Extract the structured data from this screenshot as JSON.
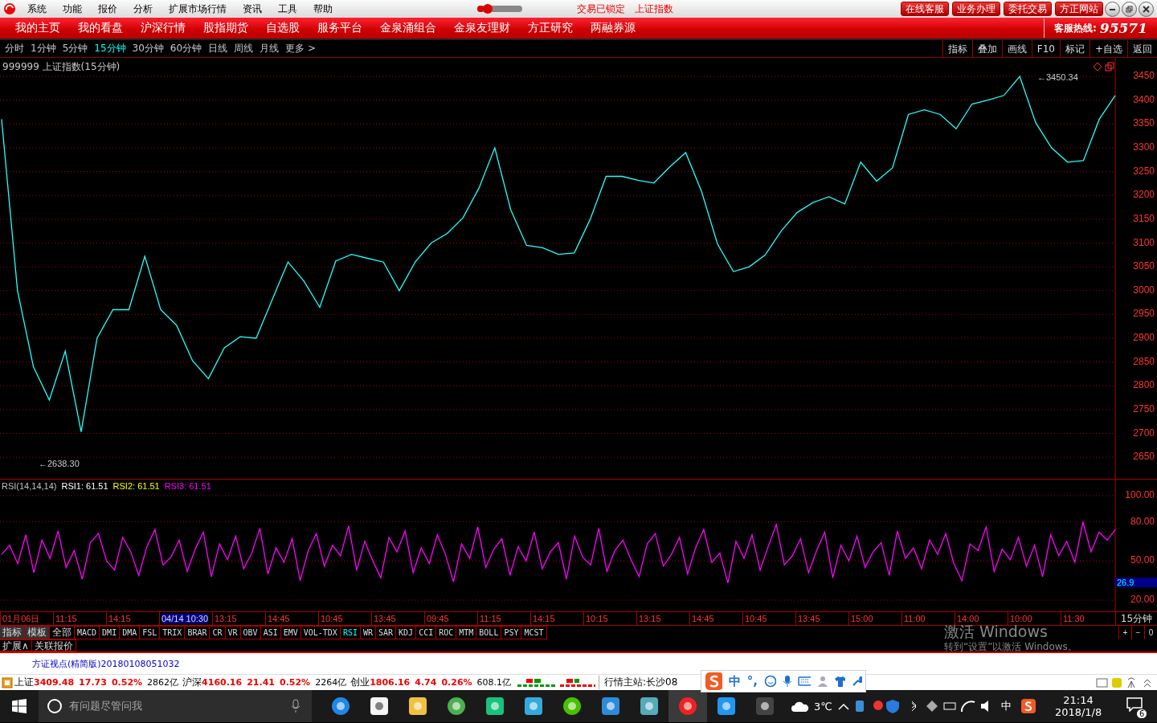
{
  "menu_bar": {
    "items": [
      "系统",
      "功能",
      "报价",
      "分析",
      "扩展市场行情",
      "资讯",
      "工具",
      "帮助"
    ],
    "slider": {
      "level": 0.15
    },
    "status_texts": [
      "交易已锁定",
      "上证指数"
    ],
    "buttons": [
      "在线客服",
      "业务办理",
      "委托交易",
      "方正网站"
    ]
  },
  "nav_bar": {
    "items": [
      "我的主页",
      "我的看盘",
      "沪深行情",
      "股指期货",
      "自选股",
      "服务平台",
      "金泉涌组合",
      "金泉友理财",
      "方正研究",
      "两融券源"
    ],
    "hotline_label": "客服热线:",
    "hotline_number": "95571"
  },
  "period_bar": {
    "periods": [
      {
        "label": "分时",
        "selected": false
      },
      {
        "label": "1分钟",
        "selected": false
      },
      {
        "label": "5分钟",
        "selected": false
      },
      {
        "label": "15分钟",
        "selected": true
      },
      {
        "label": "30分钟",
        "selected": false
      },
      {
        "label": "60分钟",
        "selected": false
      },
      {
        "label": "日线",
        "selected": false
      },
      {
        "label": "周线",
        "selected": false
      },
      {
        "label": "月线",
        "selected": false
      },
      {
        "label": "更多 >",
        "selected": false
      }
    ],
    "tools": [
      "指标",
      "叠加",
      "画线",
      "F10",
      "标记",
      "+自选",
      "返回"
    ]
  },
  "price_chart": {
    "title": "999999 上证指数(15分钟)",
    "high_label": "←3450.34",
    "low_label": "←2638.30",
    "chart_data": {
      "type": "line",
      "grid": true,
      "ylim": [
        2603,
        3489
      ],
      "yticks": [
        3450,
        3400,
        3350,
        3300,
        3250,
        3200,
        3150,
        3100,
        3050,
        3000,
        2950,
        2900,
        2850,
        2800,
        2750,
        2700,
        2650
      ],
      "series": [
        {
          "color": "#22ffff",
          "values": [
            3360,
            3000,
            2840,
            2770,
            2873,
            2703,
            2900,
            2960,
            2960,
            3072,
            2960,
            2927,
            2853,
            2815,
            2880,
            2903,
            2900,
            2980,
            3060,
            3020,
            2965,
            3062,
            3076,
            3068,
            3060,
            3000,
            3060,
            3100,
            3120,
            3153,
            3215,
            3300,
            3170,
            3095,
            3090,
            3076,
            3079,
            3150,
            3240,
            3240,
            3232,
            3226,
            3260,
            3290,
            3208,
            3098,
            3040,
            3050,
            3075,
            3125,
            3164,
            3185,
            3197,
            3182,
            3270,
            3230,
            3258,
            3370,
            3380,
            3370,
            3340,
            3392,
            3400,
            3410,
            3450,
            3353,
            3300,
            3270,
            3273,
            3360,
            3410
          ]
        }
      ]
    }
  },
  "rsi_chart": {
    "legend": [
      {
        "text": "RSI(14,14,14)",
        "color": "#c0c0c0"
      },
      {
        "text": "RSI1: 61.51",
        "color": "#ffffff"
      },
      {
        "text": "RSI2: 61.51",
        "color": "#ffff00"
      },
      {
        "text": "RSI3: 61.51",
        "color": "#ff00ff"
      }
    ],
    "cursor_value": "26.9",
    "chart_data": {
      "type": "line",
      "grid": true,
      "ylim": [
        10.8,
        112.3
      ],
      "yticks": [
        {
          "value": 100,
          "label": "100.00"
        },
        {
          "value": 80,
          "label": "80.00"
        },
        {
          "value": 50,
          "label": "50.00"
        },
        {
          "value": 20,
          "label": "20.00"
        }
      ],
      "series": [
        {
          "color": "#ff00ff",
          "values": [
            55,
            62,
            48,
            70,
            41,
            66,
            52,
            73,
            45,
            58,
            36,
            64,
            71,
            50,
            43,
            68,
            57,
            39,
            61,
            74,
            47,
            53,
            66,
            42,
            59,
            72,
            38,
            63,
            51,
            69,
            44,
            56,
            75,
            40,
            60,
            49,
            67,
            35,
            58,
            71,
            46,
            62,
            54,
            77,
            43,
            65,
            50,
            37,
            68,
            57,
            73,
            41,
            60,
            48,
            70,
            55,
            34,
            63,
            52,
            76,
            45,
            59,
            67,
            39,
            61,
            50,
            72,
            44,
            57,
            64,
            36,
            69,
            53,
            47,
            75,
            42,
            58,
            66,
            51,
            38,
            63,
            71,
            46,
            55,
            68,
            40,
            60,
            74,
            49,
            56,
            33,
            65,
            52,
            70,
            43,
            61,
            78,
            47,
            54,
            67,
            41,
            58,
            72,
            37,
            62,
            50,
            69,
            45,
            57,
            64,
            39,
            73,
            52,
            60,
            44,
            66,
            55,
            71,
            48,
            35,
            63,
            58,
            76,
            42,
            59,
            51,
            68,
            46,
            62,
            38,
            70,
            54,
            65,
            49,
            80,
            57,
            72,
            66,
            74
          ]
        }
      ]
    }
  },
  "time_axis": {
    "labels": [
      {
        "text": "01月06日",
        "selected": false
      },
      {
        "text": "11:15",
        "selected": false
      },
      {
        "text": "14:15",
        "selected": false
      },
      {
        "text": "04/14 10:30",
        "selected": true
      },
      {
        "text": "13:15",
        "selected": false
      },
      {
        "text": "14:45",
        "selected": false
      },
      {
        "text": "10:45",
        "selected": false
      },
      {
        "text": "13:45",
        "selected": false
      },
      {
        "text": "09:45",
        "selected": false
      },
      {
        "text": "11:15",
        "selected": false
      },
      {
        "text": "14:15",
        "selected": false
      },
      {
        "text": "10:15",
        "selected": false
      },
      {
        "text": "13:15",
        "selected": false
      },
      {
        "text": "14:45",
        "selected": false
      },
      {
        "text": "10:45",
        "selected": false
      },
      {
        "text": "13:45",
        "selected": false
      },
      {
        "text": "15:00",
        "selected": false
      },
      {
        "text": "11:00",
        "selected": false
      },
      {
        "text": "14:00",
        "selected": false
      },
      {
        "text": "10:00",
        "selected": false
      },
      {
        "text": "11:30",
        "selected": false
      }
    ],
    "period": "15分钟"
  },
  "indicator_tabs": {
    "items": [
      {
        "label": "指标",
        "selected": false
      },
      {
        "label": "模板",
        "selected": false
      },
      {
        "label": "全部",
        "selected": false
      },
      {
        "label": "MACD",
        "selected": false
      },
      {
        "label": "DMI",
        "selected": false
      },
      {
        "label": "DMA",
        "selected": false
      },
      {
        "label": "FSL",
        "selected": false
      },
      {
        "label": "TRIX",
        "selected": false
      },
      {
        "label": "BRAR",
        "selected": false
      },
      {
        "label": "CR",
        "selected": false
      },
      {
        "label": "VR",
        "selected": false
      },
      {
        "label": "OBV",
        "selected": false
      },
      {
        "label": "ASI",
        "selected": false
      },
      {
        "label": "EMV",
        "selected": false
      },
      {
        "label": "VOL-TDX",
        "selected": false
      },
      {
        "label": "RSI",
        "selected": true
      },
      {
        "label": "WR",
        "selected": false
      },
      {
        "label": "SAR",
        "selected": false
      },
      {
        "label": "KDJ",
        "selected": false
      },
      {
        "label": "CCI",
        "selected": false
      },
      {
        "label": "ROC",
        "selected": false
      },
      {
        "label": "MTM",
        "selected": false
      },
      {
        "label": "BOLL",
        "selected": false
      },
      {
        "label": "PSY",
        "selected": false
      },
      {
        "label": "MCST",
        "selected": false
      }
    ],
    "zoom_buttons": [
      "+",
      "−",
      "0"
    ]
  },
  "expand_row": [
    "扩展∧",
    "关联报价"
  ],
  "activation_notice": {
    "title": "激活 Windows",
    "text": "转到“设置”以激活 Windows。"
  },
  "news_link": "方证视点(精简版)20180108051032",
  "status_bar": {
    "indices": [
      {
        "name": "上证",
        "price": "3409.48",
        "change": "17.73",
        "percent": "0.52%",
        "volume": "2862亿"
      },
      {
        "name": "沪深",
        "price": "4160.16",
        "change": "21.41",
        "percent": "0.52%",
        "volume": "2264亿"
      },
      {
        "name": "创业",
        "price": "1806.16",
        "change": "4.74",
        "percent": "0.26%",
        "volume": "608.1亿"
      }
    ],
    "server": "行情主站:长沙08"
  },
  "ime_bar": {
    "items": [
      "中",
      "°,"
    ]
  },
  "taskbar": {
    "search_placeholder": "有问题尽管问我",
    "weather": "3℃",
    "tray_lang": "中",
    "time": "21:14",
    "date": "2018/1/8",
    "notifications": "6"
  }
}
